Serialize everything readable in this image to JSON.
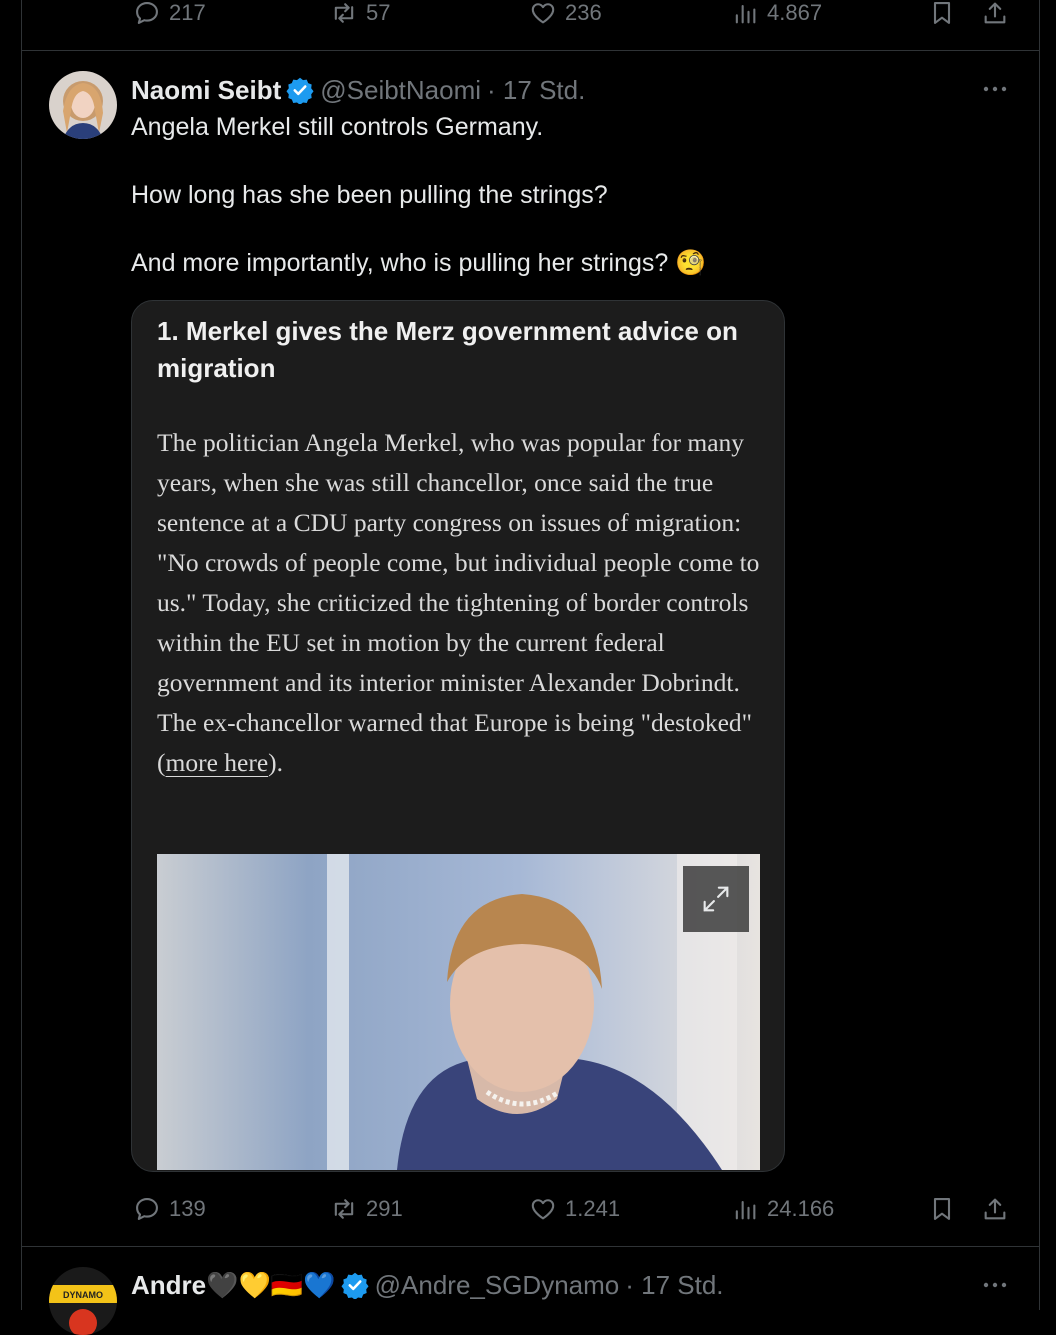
{
  "prev_tweet": {
    "stats": {
      "replies": "217",
      "retweets": "57",
      "likes": "236",
      "views": "4.867"
    }
  },
  "tweet": {
    "author_name": "Naomi Seibt",
    "handle": "@SeibtNaomi",
    "time": "· 17 Std.",
    "text_lines": [
      "Angela Merkel still controls Germany.",
      "How long has she been pulling the strings?",
      "And more importantly, who is pulling her strings? 🧐"
    ],
    "card": {
      "heading": "1. Merkel gives the Merz government advice on migration",
      "body_pre": "The politician Angela Merkel, who was popular for many years, when she was still chancellor, once said the true sentence at a CDU party congress on issues of migration: \"No crowds of people come, but individual people come to us.\" Today, she criticized the tightening of border controls within the EU set in motion by the current federal government and its interior minister Alexander Dobrindt. The ex-chancellor warned that Europe is being \"destoked\" (",
      "link_text": "more here",
      "body_post": ")."
    },
    "stats": {
      "replies": "139",
      "retweets": "291",
      "likes": "1.241",
      "views": "24.166"
    }
  },
  "next_tweet": {
    "author_name": "Andre🖤💛🇩🇪💙",
    "handle": "@Andre_SGDynamo",
    "time": "· 17 Std.",
    "avatar_text": "DYNAMO"
  },
  "colors": {
    "accent": "#1d9bf0",
    "muted": "#71767b",
    "border": "#2f3336",
    "card_bg": "#1c1c1c"
  }
}
